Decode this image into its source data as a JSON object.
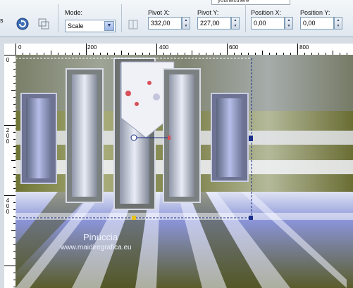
{
  "toolbar": {
    "top_strip_text": "yourtexthere",
    "mode": {
      "label": "Mode:",
      "value": "Scale"
    },
    "pivot_x": {
      "label": "Pivot X:",
      "value": "332,00"
    },
    "pivot_y": {
      "label": "Pivot Y:",
      "value": "227,00"
    },
    "position_x": {
      "label": "Position X:",
      "value": "0,00"
    },
    "position_y": {
      "label": "Position Y:",
      "value": "0,00"
    },
    "left_stub": "s"
  },
  "ruler": {
    "top_labels": [
      "0",
      "200",
      "400",
      "600",
      "800"
    ],
    "left_labels": [
      "0",
      "2\n0\n0",
      "4\n0\n0"
    ]
  },
  "watermark": {
    "name": "Pinuccia",
    "url": "www.maidiregrafica.eu"
  },
  "colors": {
    "olive": "#6e7132",
    "periwinkle": "#8a94d8",
    "light": "#e6e9f2",
    "accent": "#1b2f8a"
  }
}
